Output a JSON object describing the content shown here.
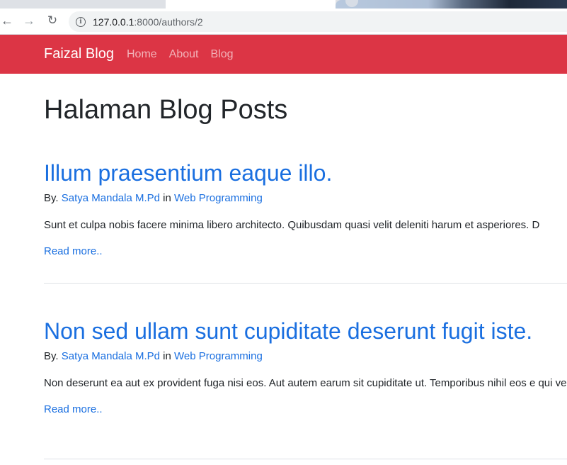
{
  "browser": {
    "url_host": "127.0.0.1",
    "url_path": ":8000/authors/2",
    "icons": [
      "back-icon",
      "forward-icon",
      "reload-icon",
      "info-icon"
    ]
  },
  "navbar": {
    "brand": "Faizal Blog",
    "links": [
      "Home",
      "About",
      "Blog"
    ],
    "color": "#dc3545"
  },
  "page": {
    "title": "Halaman Blog Posts"
  },
  "posts": [
    {
      "title": "Illum praesentium eaque illo.",
      "by_label": "By.",
      "author": "Satya Mandala M.Pd",
      "in_label": "in",
      "category": "Web Programming",
      "excerpt": "Sunt et culpa nobis facere minima libero architecto. Quibusdam quasi velit deleniti harum et asperiores. D",
      "read_more": "Read more.."
    },
    {
      "title": "Non sed ullam sunt cupiditate deserunt fugit iste.",
      "by_label": "By.",
      "author": "Satya Mandala M.Pd",
      "in_label": "in",
      "category": "Web Programming",
      "excerpt": "Non deserunt ea aut ex provident fuga nisi eos. Aut autem earum sit cupiditate ut. Temporibus nihil eos e qui velit.",
      "read_more": "Read more.."
    }
  ],
  "colors": {
    "link": "#1a6fe0",
    "text": "#212529"
  }
}
